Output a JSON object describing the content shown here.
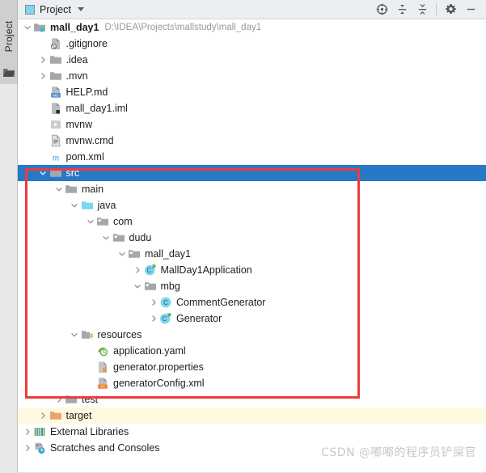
{
  "toolstrip": {
    "tab_label": "Project",
    "tab_icon": "project-window-icon"
  },
  "header": {
    "title": "Project",
    "icon": "project-view-icon",
    "caret_icon": "chevron-down-icon",
    "buttons": [
      {
        "name": "select-opened-file-icon",
        "label": "Select Opened File"
      },
      {
        "name": "expand-all-icon",
        "label": "Expand All"
      },
      {
        "name": "collapse-all-icon",
        "label": "Collapse All"
      },
      {
        "name": "settings-gear-icon",
        "label": "Settings"
      },
      {
        "name": "hide-minimize-icon",
        "label": "Hide"
      }
    ]
  },
  "colors": {
    "selection_blue": "#2878c8",
    "annotation_red": "#ea3d3d",
    "target_highlight": "#fdfae0",
    "header_bg": "#eceff1",
    "path_gray": "#9a9a9a"
  },
  "tree": {
    "rows": [
      {
        "label": "mall_day1",
        "path": "D:\\IDEA\\Projects\\mallstudy\\mall_day1",
        "depth": 0,
        "arrow": "expanded",
        "icon": "module-folder-icon",
        "bold": true,
        "selected": false
      },
      {
        "label": ".gitignore",
        "path": "",
        "depth": 1,
        "arrow": "none",
        "icon": "gitignore-file-icon",
        "bold": false,
        "selected": false
      },
      {
        "label": ".idea",
        "path": "",
        "depth": 1,
        "arrow": "collapsed",
        "icon": "folder-icon",
        "bold": false,
        "selected": false
      },
      {
        "label": ".mvn",
        "path": "",
        "depth": 1,
        "arrow": "collapsed",
        "icon": "folder-icon",
        "bold": false,
        "selected": false
      },
      {
        "label": "HELP.md",
        "path": "",
        "depth": 1,
        "arrow": "none",
        "icon": "markdown-file-icon",
        "bold": false,
        "selected": false
      },
      {
        "label": "mall_day1.iml",
        "path": "",
        "depth": 1,
        "arrow": "none",
        "icon": "iml-file-icon",
        "bold": false,
        "selected": false
      },
      {
        "label": "mvnw",
        "path": "",
        "depth": 1,
        "arrow": "none",
        "icon": "shell-script-icon",
        "bold": false,
        "selected": false
      },
      {
        "label": "mvnw.cmd",
        "path": "",
        "depth": 1,
        "arrow": "none",
        "icon": "text-file-icon",
        "bold": false,
        "selected": false
      },
      {
        "label": "pom.xml",
        "path": "",
        "depth": 1,
        "arrow": "none",
        "icon": "maven-pom-icon",
        "bold": false,
        "selected": false
      },
      {
        "label": "src",
        "path": "",
        "depth": 1,
        "arrow": "expanded",
        "icon": "folder-icon",
        "bold": false,
        "selected": true
      },
      {
        "label": "main",
        "path": "",
        "depth": 2,
        "arrow": "expanded",
        "icon": "folder-icon",
        "bold": false,
        "selected": false
      },
      {
        "label": "java",
        "path": "",
        "depth": 3,
        "arrow": "expanded",
        "icon": "source-root-folder-icon",
        "bold": false,
        "selected": false
      },
      {
        "label": "com",
        "path": "",
        "depth": 4,
        "arrow": "expanded",
        "icon": "package-icon",
        "bold": false,
        "selected": false
      },
      {
        "label": "dudu",
        "path": "",
        "depth": 5,
        "arrow": "expanded",
        "icon": "package-icon",
        "bold": false,
        "selected": false
      },
      {
        "label": "mall_day1",
        "path": "",
        "depth": 6,
        "arrow": "expanded",
        "icon": "package-icon",
        "bold": false,
        "selected": false
      },
      {
        "label": "MallDay1Application",
        "path": "",
        "depth": 7,
        "arrow": "collapsed",
        "icon": "runnable-java-class-icon",
        "bold": false,
        "selected": false
      },
      {
        "label": "mbg",
        "path": "",
        "depth": 7,
        "arrow": "expanded",
        "icon": "package-icon",
        "bold": false,
        "selected": false
      },
      {
        "label": "CommentGenerator",
        "path": "",
        "depth": 8,
        "arrow": "collapsed",
        "icon": "java-class-icon",
        "bold": false,
        "selected": false
      },
      {
        "label": "Generator",
        "path": "",
        "depth": 8,
        "arrow": "collapsed",
        "icon": "runnable-java-class-icon",
        "bold": false,
        "selected": false
      },
      {
        "label": "resources",
        "path": "",
        "depth": 3,
        "arrow": "expanded",
        "icon": "resource-root-folder-icon",
        "bold": false,
        "selected": false
      },
      {
        "label": "application.yaml",
        "path": "",
        "depth": 4,
        "arrow": "none",
        "icon": "spring-yaml-icon",
        "bold": false,
        "selected": false
      },
      {
        "label": "generator.properties",
        "path": "",
        "depth": 4,
        "arrow": "none",
        "icon": "properties-file-icon",
        "bold": false,
        "selected": false
      },
      {
        "label": "generatorConfig.xml",
        "path": "",
        "depth": 4,
        "arrow": "none",
        "icon": "xml-file-icon",
        "bold": false,
        "selected": false
      },
      {
        "label": "test",
        "path": "",
        "depth": 2,
        "arrow": "collapsed",
        "icon": "folder-icon",
        "bold": false,
        "selected": false
      },
      {
        "label": "target",
        "path": "",
        "depth": 1,
        "arrow": "collapsed",
        "icon": "excluded-folder-icon",
        "bold": false,
        "selected": false,
        "highlight": true
      },
      {
        "label": "External Libraries",
        "path": "",
        "depth": 0,
        "arrow": "collapsed",
        "icon": "external-libraries-icon",
        "bold": false,
        "selected": false
      },
      {
        "label": "Scratches and Consoles",
        "path": "",
        "depth": 0,
        "arrow": "collapsed",
        "icon": "scratches-icon",
        "bold": false,
        "selected": false
      }
    ]
  },
  "annotation": {
    "name": "red-highlight-rectangle"
  },
  "watermark": {
    "text": "CSDN @嘟嘟的程序员铲屎官"
  }
}
